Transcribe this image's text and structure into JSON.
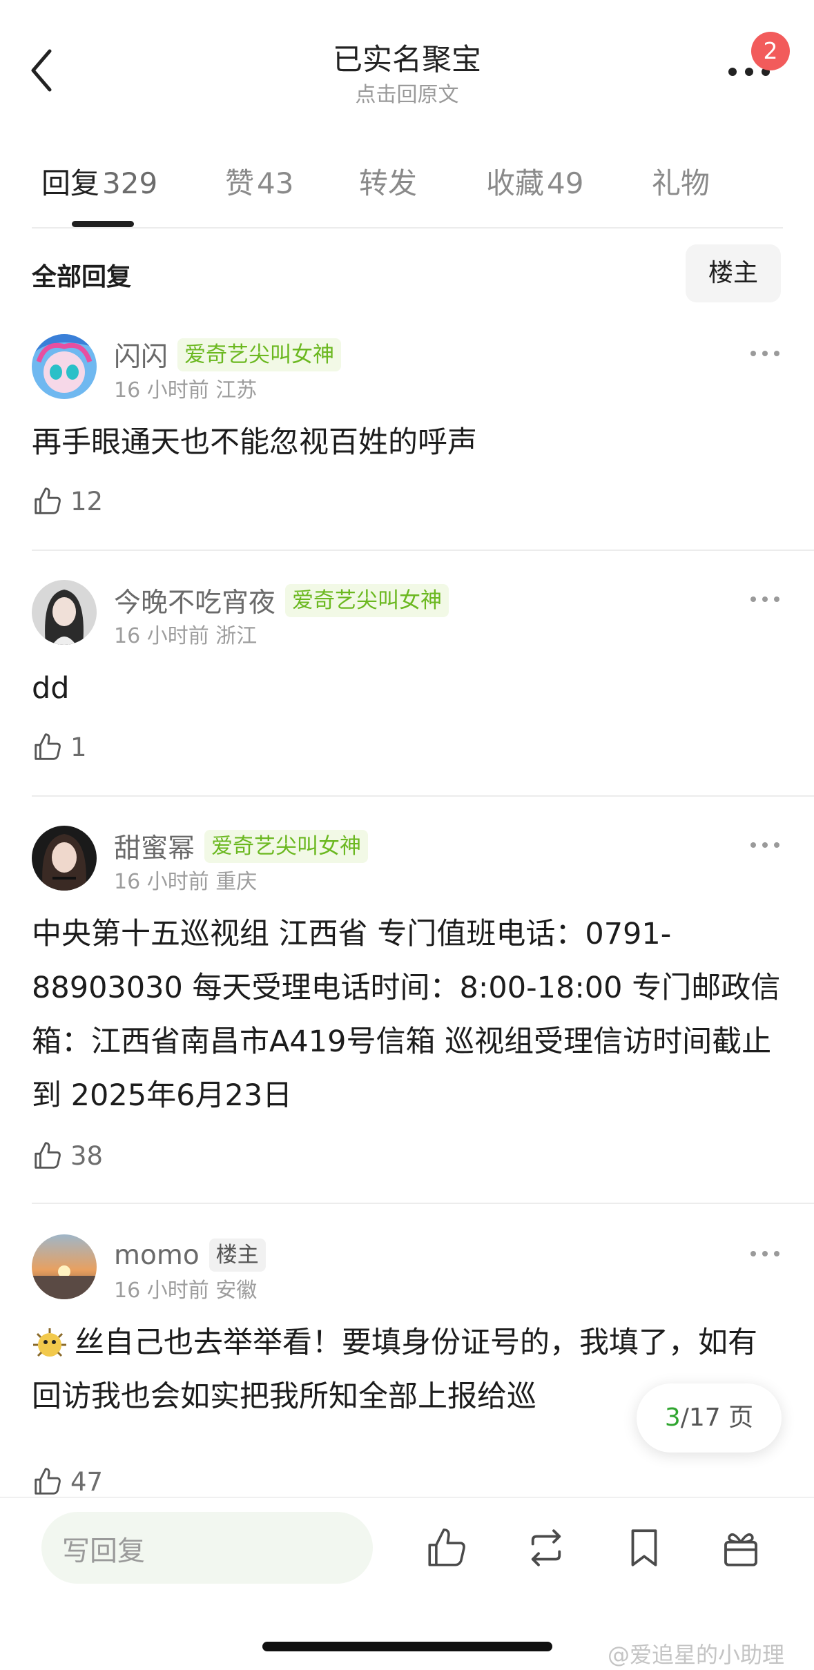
{
  "header": {
    "title": "已实名聚宝",
    "subtitle": "点击回原文",
    "notification_count": "2"
  },
  "tabs": [
    {
      "label": "回复",
      "count": "329",
      "active": true
    },
    {
      "label": "赞",
      "count": "43",
      "active": false
    },
    {
      "label": "转发",
      "count": "",
      "active": false
    },
    {
      "label": "收藏",
      "count": "49",
      "active": false
    },
    {
      "label": "礼物",
      "count": "",
      "active": false
    }
  ],
  "section": {
    "title": "全部回复",
    "owner_filter": "楼主"
  },
  "comments": [
    {
      "username": "闪闪",
      "tag": "爱奇艺尖叫女神",
      "time": "16 小时前",
      "location": "江苏",
      "text": "再手眼通天也不能忽视百姓的呼声",
      "likes": "12"
    },
    {
      "username": "今晚不吃宵夜",
      "tag": "爱奇艺尖叫女神",
      "time": "16 小时前",
      "location": "浙江",
      "text": "dd",
      "likes": "1"
    },
    {
      "username": "甜蜜幂",
      "tag": "爱奇艺尖叫女神",
      "time": "16 小时前",
      "location": "重庆",
      "text": "中央第十五巡视组  江西省  专门值班电话：0791-88903030  每天受理电话时间：8:00-18:00  专门邮政信箱：江西省南昌市A419号信箱  巡视组受理信访时间截止到 2025年6月23日",
      "likes": "38"
    },
    {
      "username": "momo",
      "tag": "楼主",
      "time": "16 小时前",
      "location": "安徽",
      "text": "丝自己也去举举看！要填身份证号的，我填了，如有回访我也会如实把我所知全部上报给巡",
      "likes": "47"
    }
  ],
  "pagination": {
    "current": "3",
    "total_label": "/17 页"
  },
  "bottom_bar": {
    "reply_placeholder": "写回复"
  },
  "watermark": "@爱追星的小助理",
  "colors": {
    "accent_green": "#6bb820",
    "badge_red": "#f25b5b",
    "page_current": "#2fa52f"
  }
}
